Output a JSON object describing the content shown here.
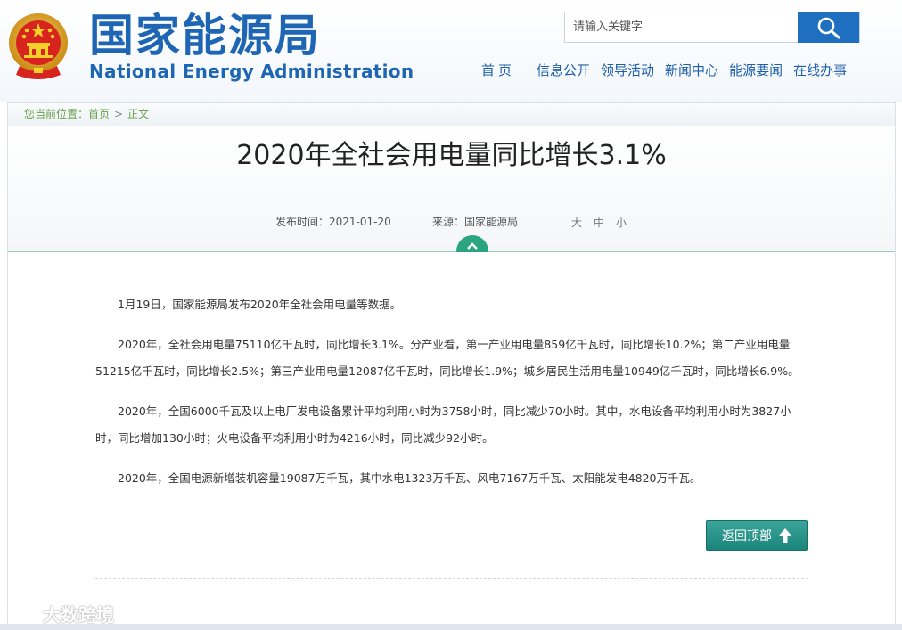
{
  "header": {
    "site_title_cn": "国家能源局",
    "site_title_en": "National Energy Administration",
    "search": {
      "placeholder": "请输入关键字"
    },
    "nav": [
      {
        "label": "首页"
      },
      {
        "label": "信息公开"
      },
      {
        "label": "领导活动"
      },
      {
        "label": "新闻中心"
      },
      {
        "label": "能源要闻"
      },
      {
        "label": "在线办事"
      }
    ]
  },
  "breadcrumb": {
    "prefix": "您当前位置：",
    "home": "首页",
    "separator": ">",
    "current": "正文"
  },
  "article": {
    "title": "2020年全社会用电量同比增长3.1%",
    "date_label": "发布时间：2021-01-20",
    "source_label": "来源：国家能源局",
    "font_sizes": [
      "大",
      "中",
      "小"
    ],
    "paragraphs": [
      "1月19日，国家能源局发布2020年全社会用电量等数据。",
      "2020年，全社会用电量75110亿千瓦时，同比增长3.1%。分产业看，第一产业用电量859亿千瓦时，同比增长10.2%；第二产业用电量51215亿千瓦时，同比增长2.5%；第三产业用电量12087亿千瓦时，同比增长1.9%；城乡居民生活用电量10949亿千瓦时，同比增长6.9%。",
      "2020年，全国6000千瓦及以上电厂发电设备累计平均利用小时为3758小时，同比减少70小时。其中，水电设备平均利用小时为3827小时，同比增加130小时；火电设备平均利用小时为4216小时，同比减少92小时。",
      "2020年，全国电源新增装机容量19087万千瓦，其中水电1323万千瓦、风电7167万千瓦、太阳能发电4820万千瓦。"
    ],
    "back_to_top": "返回顶部"
  },
  "watermark": "大数跨境",
  "colors": {
    "brand_blue": "#1e66b4",
    "search_button": "#1f6fc0",
    "accent_green": "#2aa57f",
    "breadcrumb_green": "#6aa14e"
  },
  "icons": {
    "emblem": "national-emblem-icon",
    "search": "search-icon",
    "collapse": "chevron-up-icon",
    "back_to_top": "arrow-up-icon"
  }
}
